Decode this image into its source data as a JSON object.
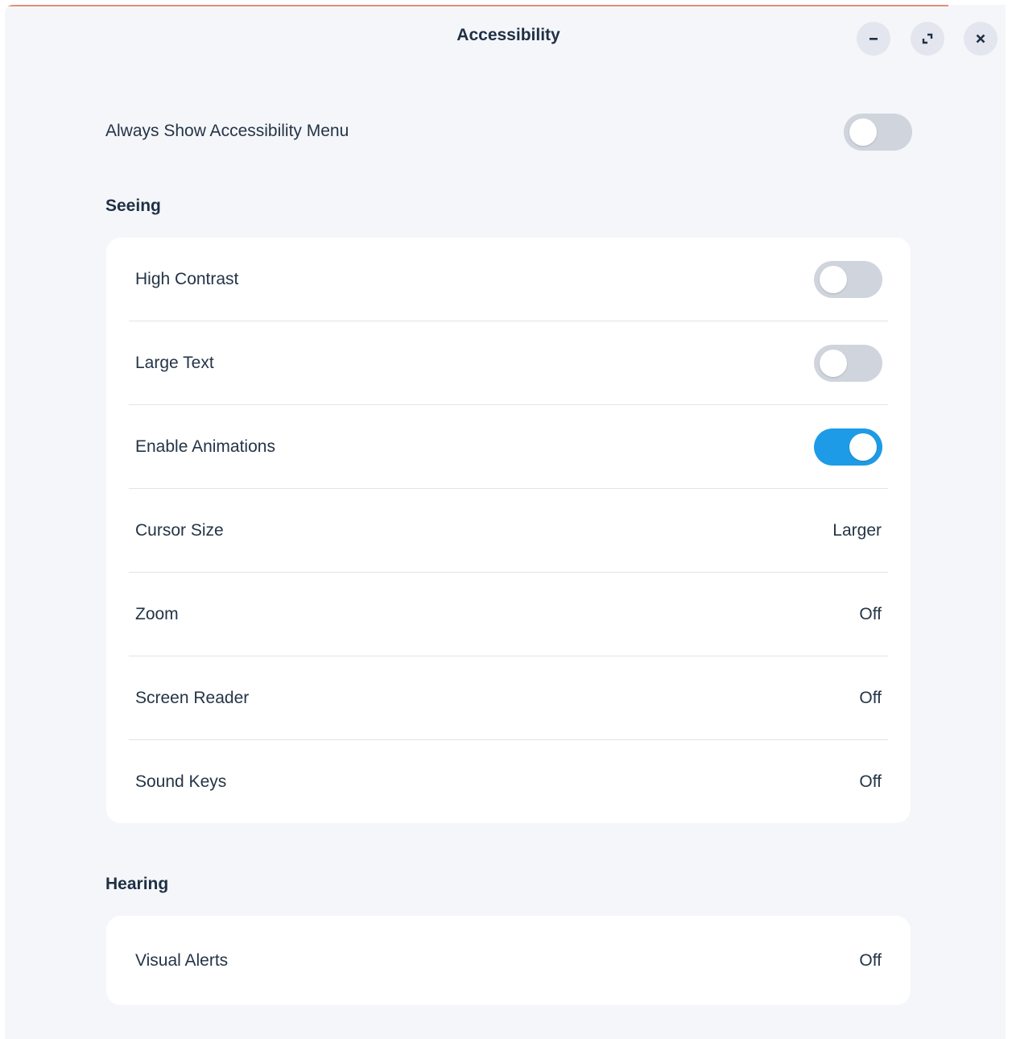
{
  "window": {
    "title": "Accessibility"
  },
  "top_setting": {
    "label": "Always Show Accessibility Menu",
    "enabled": false
  },
  "sections": {
    "seeing": {
      "heading": "Seeing",
      "rows": [
        {
          "label": "High Contrast",
          "type": "toggle",
          "enabled": false
        },
        {
          "label": "Large Text",
          "type": "toggle",
          "enabled": false
        },
        {
          "label": "Enable Animations",
          "type": "toggle",
          "enabled": true
        },
        {
          "label": "Cursor Size",
          "type": "value",
          "value": "Larger"
        },
        {
          "label": "Zoom",
          "type": "value",
          "value": "Off"
        },
        {
          "label": "Screen Reader",
          "type": "value",
          "value": "Off"
        },
        {
          "label": "Sound Keys",
          "type": "value",
          "value": "Off"
        }
      ]
    },
    "hearing": {
      "heading": "Hearing",
      "rows": [
        {
          "label": "Visual Alerts",
          "type": "value",
          "value": "Off"
        }
      ]
    }
  },
  "icons": {
    "minimize": "minimize-icon",
    "maximize": "maximize-icon",
    "close": "close-icon"
  },
  "colors": {
    "background": "#f5f6fa",
    "card": "#ffffff",
    "toggle_on": "#1e9be6",
    "toggle_off": "#cfd4dd",
    "text": "#243447"
  }
}
